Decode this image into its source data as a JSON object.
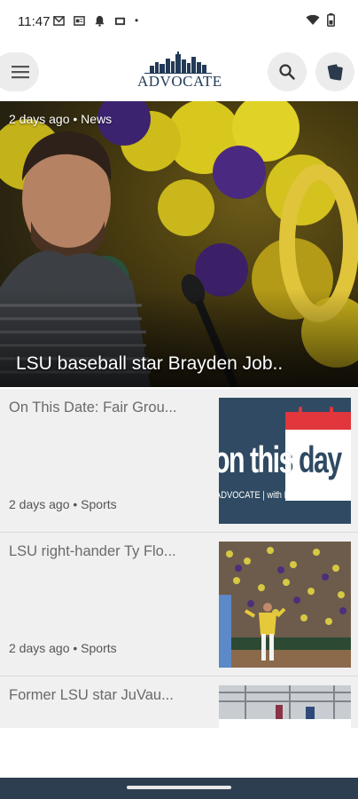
{
  "status_bar": {
    "time": "11:47",
    "dot": "•",
    "left_icons": [
      "gmail-icon",
      "news-icon",
      "notification-icon",
      "cast-icon"
    ],
    "right_icons": [
      "wifi-icon",
      "battery-icon"
    ]
  },
  "app_bar": {
    "logo_text": "ADVOCATE",
    "menu_icon": "hamburger-icon",
    "search_icon": "search-icon",
    "edition_icon": "e-edition-icon"
  },
  "hero": {
    "meta": "2 days ago • News",
    "title": "LSU baseball star Brayden Job.."
  },
  "articles": [
    {
      "title": "On This Date: Fair Grou...",
      "meta": "2 days ago • Sports",
      "thumb_line1": "on this day",
      "thumb_line2": "ADVOCATE | with Roy Lang III"
    },
    {
      "title": "LSU right-hander Ty Flo...",
      "meta": "2 days ago • Sports"
    },
    {
      "title": "Former LSU star JuVau..."
    }
  ],
  "colors": {
    "brand_navy": "#223a57",
    "thumb_blue": "#2f4a62",
    "thumb_red": "#e0363c",
    "nav_bar": "#2c3e50"
  }
}
